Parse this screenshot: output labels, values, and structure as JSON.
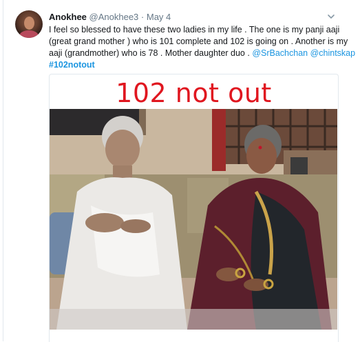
{
  "tweet": {
    "author_name": "Anokhee",
    "author_handle": "@Anokhee3",
    "separator": "·",
    "date": "May 4",
    "text_lines": [
      "I feel so blessed to have these two ladies in my life . The one is my panji aaji",
      "(great grand mother ) who is 101 complete and 102 is going on . Another is my"
    ],
    "line3_text": "aaji (grandmother) who is 78 . Mother daughter duo  . ",
    "mentions": [
      "@SrBachchan",
      "@chintskap"
    ],
    "hashtag": "#102notout",
    "menu_icon": "chevron-down-icon"
  },
  "media": {
    "title": "102 not out",
    "title_color": "#e0161f",
    "image_subject": "photo-of-two-elderly-women"
  },
  "colors": {
    "link": "#1b95e0",
    "text": "#14171a",
    "meta": "#657786"
  }
}
